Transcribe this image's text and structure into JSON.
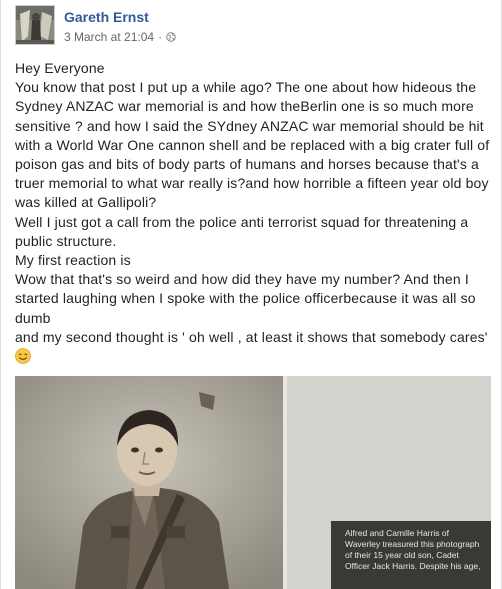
{
  "post": {
    "author": "Gareth Ernst",
    "timestamp": "3 March at 21:04",
    "separator": "·",
    "privacy_icon": "globe-icon",
    "paragraphs": [
      "Hey Everyone",
      "You know that post I put up a while ago? The one about how hideous the Sydney ANZAC war memorial is and how theBerlin one is so much more sensitive ? and how I said the SYdney ANZAC war memorial should be hit with a World War One cannon shell and be replaced with a big crater full of poison gas and bits of body parts of humans and horses because that's a truer memorial to what war really is?and how horrible a fifteen year old boy was killed at Gallipoli?",
      "Well I just got a call from the police anti terrorist squad for threatening a public structure.",
      "My first reaction is",
      "Wow that that's so weird and how did they have my number? And then I started laughing when I spoke with the police officerbecause it was all so dumb",
      "and my second thought is ' oh well , at least it shows that somebody cares'"
    ],
    "emoji": "smiling-face-emoji",
    "photo": {
      "caption_lines": [
        "Alfred and Camille Harris of",
        "Waverley treasured this photograph",
        "of their 15 year old son, Cadet",
        "Officer Jack Harris. Despite his age,"
      ]
    }
  },
  "colors": {
    "author": "#365899",
    "meta": "#616770",
    "text": "#1d2129"
  }
}
